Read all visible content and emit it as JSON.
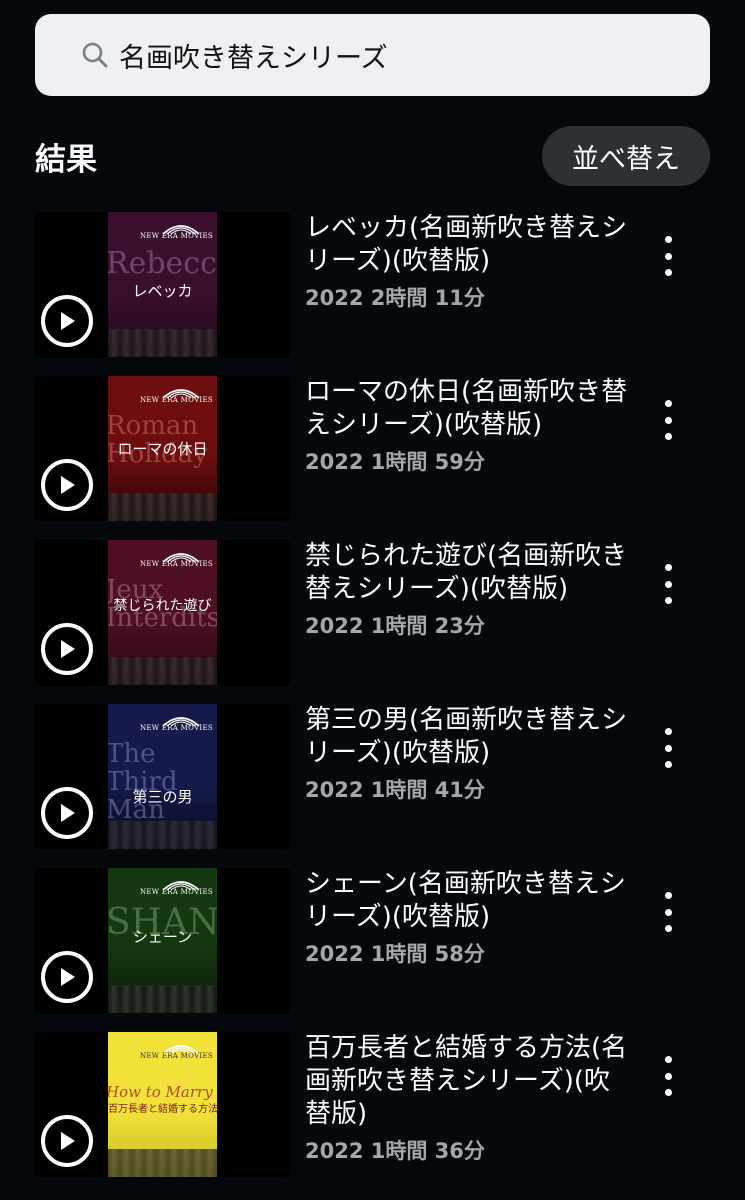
{
  "search": {
    "query": "名画吹き替えシリーズ",
    "icon": "search-icon"
  },
  "results_header": {
    "title": "結果",
    "sort_label": "並べ替え"
  },
  "logo": {
    "brand": "NEW ERA MOVIES",
    "series_jp": "名画 新吹き替えシリーズ"
  },
  "results": [
    {
      "title": "レベッカ(名画新吹き替えシリーズ)(吹替版)",
      "meta": "2022 2時間 11分",
      "poster": {
        "bg": "#3a0f2e",
        "bg2": "#1e0818",
        "big_title": "Rebecca",
        "big_color": "#a06a98",
        "jp_title": "レベッカ"
      }
    },
    {
      "title": "ローマの休日(名画新吹き替えシリーズ)(吹替版)",
      "meta": "2022 1時間 59分",
      "poster": {
        "bg": "#6e0d0d",
        "bg2": "#2a0505",
        "big_title": "Roman\nHoliday",
        "big_color": "#c46a6a",
        "jp_title": "ローマの休日"
      }
    },
    {
      "title": "禁じられた遊び(名画新吹き替えシリーズ)(吹替版)",
      "meta": "2022 1時間 23分",
      "poster": {
        "bg": "#4e0f26",
        "bg2": "#24060f",
        "big_title": "Jeux\nInterdits",
        "big_color": "#b07a8e",
        "jp_title": "禁じられた遊び"
      }
    },
    {
      "title": "第三の男(名画新吹き替えシリーズ)(吹替版)",
      "meta": "2022 1時間 41分",
      "poster": {
        "bg": "#151a4a",
        "bg2": "#080a22",
        "big_title": "The\nThird\nMan",
        "big_color": "#7b83b8",
        "jp_title": "第三の男"
      }
    },
    {
      "title": "シェーン(名画新吹き替えシリーズ)(吹替版)",
      "meta": "2022 1時間 58分",
      "poster": {
        "bg": "#14380f",
        "bg2": "#081a06",
        "big_title": "SHANE",
        "big_color": "#6fa066",
        "jp_title": "シェーン"
      }
    },
    {
      "title": "百万長者と結婚する方法(名画新吹き替えシリーズ)(吹替版)",
      "meta": "2022 1時間 36分",
      "poster": {
        "bg": "#f2e23a",
        "bg2": "#c9b820",
        "big_title": "How to Marry",
        "big_color": "#b53a1a",
        "jp_title": "百万長者と結婚する方法"
      }
    }
  ]
}
